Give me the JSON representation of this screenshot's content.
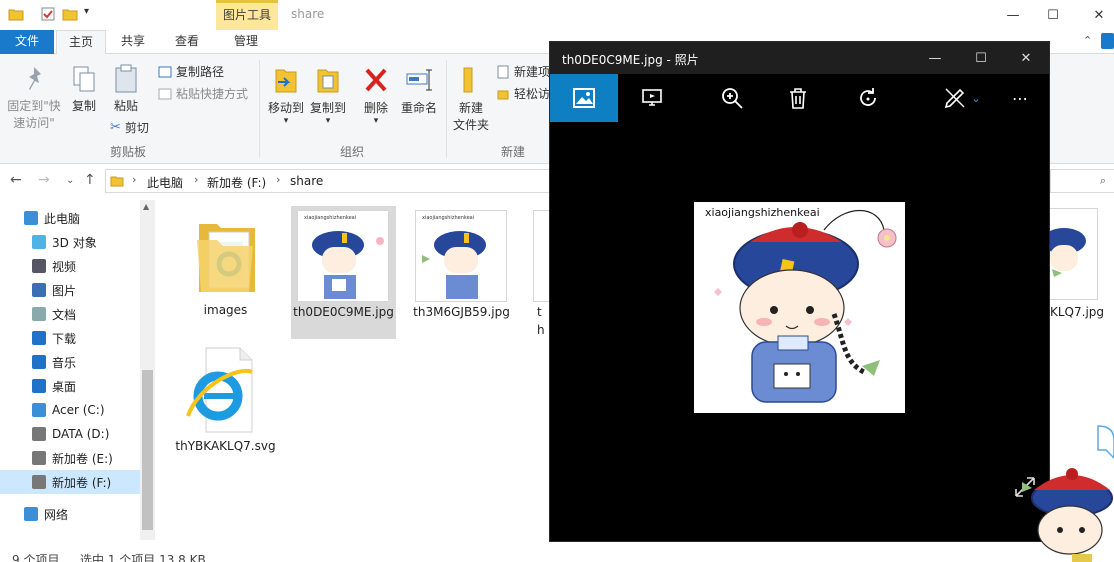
{
  "explorer": {
    "window_title": "share",
    "context_tab": "图片工具",
    "tabs": {
      "file": "文件",
      "home": "主页",
      "share": "共享",
      "view": "查看",
      "manage": "管理"
    },
    "ribbon": {
      "pin_quick_access": "固定到\"快\n速访问\"",
      "copy": "复制",
      "paste": "粘贴",
      "copy_path": "复制路径",
      "paste_shortcut": "粘贴快捷方式",
      "cut": "剪切",
      "group_clipboard": "剪贴板",
      "move_to": "移动到",
      "copy_to": "复制到",
      "delete": "删除",
      "rename": "重命名",
      "group_organize": "组织",
      "new_folder": "新建\n文件夹",
      "new_item": "新建项",
      "easy_access": "轻松访",
      "group_new": "新建"
    },
    "breadcrumb": [
      "此电脑",
      "新加卷 (F:)",
      "share"
    ],
    "nav_pane": [
      {
        "label": "此电脑",
        "icon": "computer-icon"
      },
      {
        "label": "3D 对象",
        "icon": "cube-icon"
      },
      {
        "label": "视频",
        "icon": "video-icon"
      },
      {
        "label": "图片",
        "icon": "picture-icon"
      },
      {
        "label": "文档",
        "icon": "document-icon"
      },
      {
        "label": "下载",
        "icon": "download-icon"
      },
      {
        "label": "音乐",
        "icon": "music-icon"
      },
      {
        "label": "桌面",
        "icon": "desktop-icon"
      },
      {
        "label": "Acer (C:)",
        "icon": "windows-drive-icon"
      },
      {
        "label": "DATA (D:)",
        "icon": "drive-icon"
      },
      {
        "label": "新加卷 (E:)",
        "icon": "drive-icon"
      },
      {
        "label": "新加卷 (F:)",
        "icon": "drive-icon"
      },
      {
        "label": "网络",
        "icon": "network-icon"
      }
    ],
    "files": [
      {
        "name": "images",
        "type": "folder"
      },
      {
        "name": "th0DE0C9ME.jpg",
        "type": "jpg"
      },
      {
        "name": "th3M6GJB59.jpg",
        "type": "jpg"
      },
      {
        "name": "th",
        "type": "jpg"
      },
      {
        "name": "thYBKAKLQ7.svg",
        "type": "svg"
      }
    ],
    "edge_file_name": "KLQ7.jpg",
    "status": {
      "count": "9 个项目",
      "selected": "选中 1 个项目  13.8 KB"
    }
  },
  "photos": {
    "title": "th0DE0C9ME.jpg - 照片",
    "image_caption": "xiaojiangshizhenkeai"
  },
  "colors": {
    "accent": "#1979ca",
    "photos_accent": "#0f7fc3",
    "context_tab": "#fce79a"
  }
}
